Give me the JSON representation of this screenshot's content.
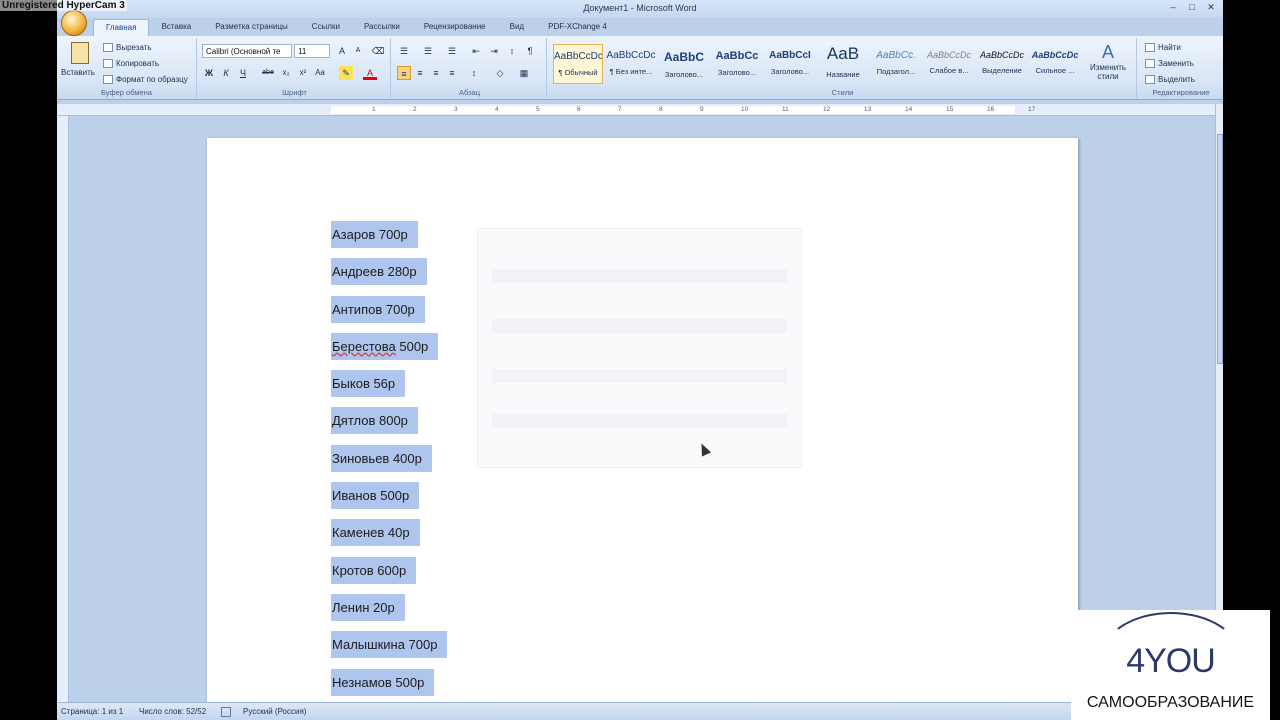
{
  "window": {
    "title": "Документ1 - Microsoft Word",
    "recorder_label": "Unregistered HyperCam 3",
    "controls": [
      "–",
      "□",
      "✕"
    ]
  },
  "tabs": [
    "Главная",
    "Вставка",
    "Разметка страницы",
    "Ссылки",
    "Рассылки",
    "Рецензирование",
    "Вид",
    "PDF-XChange 4"
  ],
  "ribbon": {
    "clipboard": {
      "paste": "Вставить",
      "cut": "Вырезать",
      "copy": "Копировать",
      "format_painter": "Формат по образцу",
      "label": "Буфер обмена"
    },
    "font": {
      "name": "Calibri (Основной те",
      "size": "11",
      "label": "Шрифт",
      "buttons": [
        "Ж",
        "К",
        "Ч",
        "abe",
        "x₂",
        "x²",
        "Aa"
      ]
    },
    "paragraph": {
      "label": "Абзац"
    },
    "styles": {
      "label": "Стили",
      "items": [
        {
          "preview": "AaBbCcDc",
          "name": "¶ Обычный"
        },
        {
          "preview": "AaBbCcDc",
          "name": "¶ Без инте..."
        },
        {
          "preview": "AaBbC",
          "name": "Заголово..."
        },
        {
          "preview": "AaBbCc",
          "name": "Заголово..."
        },
        {
          "preview": "AaBbCcI",
          "name": "Заголово..."
        },
        {
          "preview": "AaB",
          "name": "Название"
        },
        {
          "preview": "AaBbCc.",
          "name": "Подзагол..."
        },
        {
          "preview": "AaBbCcDc",
          "name": "Слабое в..."
        },
        {
          "preview": "AaBbCcDc",
          "name": "Выделение"
        },
        {
          "preview": "AaBbCcDc",
          "name": "Сильное ..."
        }
      ],
      "change": "Изменить стили"
    },
    "editing": {
      "label": "Редактирование",
      "find": "Найти",
      "replace": "Заменить",
      "select": "Выделить"
    }
  },
  "ruler_numbers": [
    "1",
    "2",
    "3",
    "4",
    "5",
    "6",
    "7",
    "8",
    "9",
    "10",
    "11",
    "12",
    "13",
    "14",
    "15",
    "16",
    "17"
  ],
  "document": {
    "lines": [
      "Азаров 700р",
      "Андреев 280р",
      "Антипов 700р",
      "Берестова 500р",
      "Быков 56р",
      "Дятлов 800р",
      "Зиновьев 400р",
      "Иванов 500р",
      "Каменев 40р",
      "Кротов 600р",
      "Ленин 20р",
      "Малышкина 700р",
      "Незнамов 500р"
    ]
  },
  "status": {
    "page": "Страница: 1 из 1",
    "words": "Число слов: 52/52",
    "language": "Русский (Россия)"
  },
  "logo": {
    "brand": "4YOU",
    "subtitle": "САМООБРАЗОВАНИЕ"
  }
}
